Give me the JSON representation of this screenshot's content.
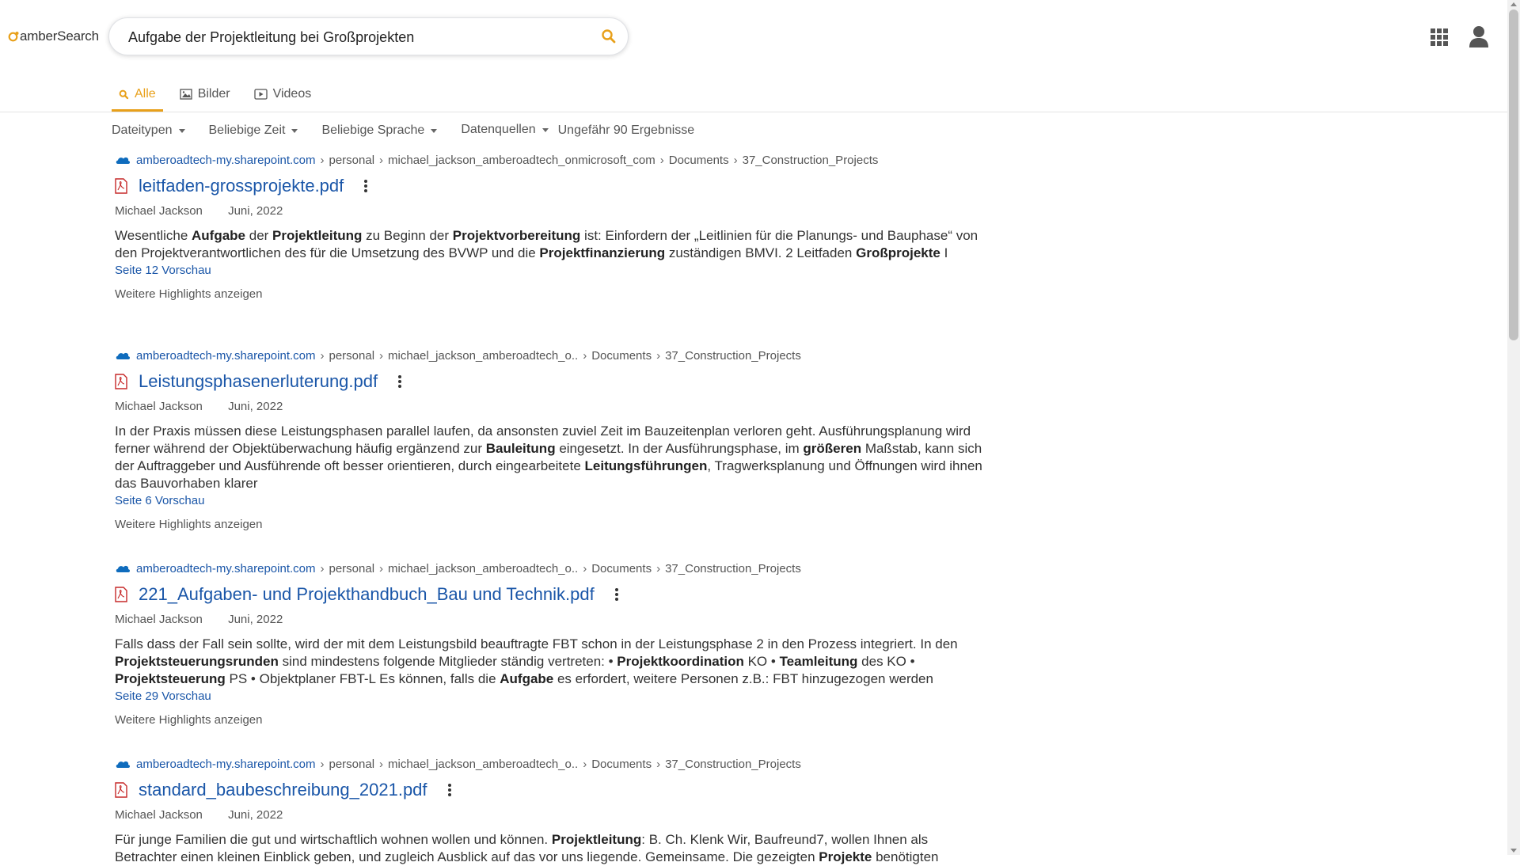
{
  "brand": {
    "name": "amberSearch",
    "accent_color": "#e8a01a",
    "link_color": "#1a56a8"
  },
  "search": {
    "query": "Aufgabe der Projektleitung bei Großprojekten"
  },
  "tabs": [
    {
      "label": "Alle",
      "icon": "search-icon",
      "active": true
    },
    {
      "label": "Bilder",
      "icon": "image-icon",
      "active": false
    },
    {
      "label": "Videos",
      "icon": "video-icon",
      "active": false
    }
  ],
  "filters": {
    "filetypes": "Dateitypen",
    "time": "Beliebige Zeit",
    "language": "Beliebige Sprache",
    "sources": "Datenquellen",
    "result_count": "Ungefähr 90 Ergebnisse"
  },
  "results": [
    {
      "host": "amberoadtech-my.sharepoint.com",
      "path": [
        "personal",
        "michael_jackson_amberoadtech_onmicrosoft_com",
        "Documents",
        "37_Construction_Projects"
      ],
      "title": "leitfaden-grossprojekte.pdf",
      "author": "Michael Jackson",
      "date": "Juni, 2022",
      "snippet": [
        {
          "t": "Wesentliche "
        },
        {
          "t": "Aufgabe",
          "b": true
        },
        {
          "t": " der "
        },
        {
          "t": "Projektleitung",
          "b": true
        },
        {
          "t": " zu Beginn der "
        },
        {
          "t": "Projektvorbereitung",
          "b": true
        },
        {
          "t": " ist: Einfordern der „Leitlinien für die Planungs- und Bauphase“ von den Projektverantwortlichen des für die Umsetzung des BVWP und die "
        },
        {
          "t": "Projektfinanzierung",
          "b": true
        },
        {
          "t": " zuständigen BMVI. 2 Leitfaden "
        },
        {
          "t": "Großprojekte",
          "b": true
        },
        {
          "t": " I"
        }
      ],
      "preview": "Seite 12 Vorschau",
      "highlights": "Weitere Highlights anzeigen"
    },
    {
      "host": "amberoadtech-my.sharepoint.com",
      "path": [
        "personal",
        "michael_jackson_amberoadtech_o..",
        "Documents",
        "37_Construction_Projects"
      ],
      "title": "Leistungsphasenerluterung.pdf",
      "author": "Michael Jackson",
      "date": "Juni, 2022",
      "snippet": [
        {
          "t": "In der Praxis müssen diese Leistungsphasen parallel laufen, da ansonsten zuviel Zeit im Bauzeitenplan verloren geht. Ausführungsplanung wird ferner während der Objektüberwachung häufig ergänzend zur "
        },
        {
          "t": "Bauleitung",
          "b": true
        },
        {
          "t": " eingesetzt. In der Ausführungsphase, im "
        },
        {
          "t": "größeren",
          "b": true
        },
        {
          "t": " Maßstab, kann sich der Auftraggeber und Ausführende oft besser orientieren, durch eingearbeitete "
        },
        {
          "t": "Leitungsführungen",
          "b": true
        },
        {
          "t": ", Tragwerksplanung und Öffnungen wird ihnen das Bauvorhaben klarer"
        }
      ],
      "preview": "Seite 6 Vorschau",
      "highlights": "Weitere Highlights anzeigen"
    },
    {
      "host": "amberoadtech-my.sharepoint.com",
      "path": [
        "personal",
        "michael_jackson_amberoadtech_o..",
        "Documents",
        "37_Construction_Projects"
      ],
      "title": "221_Aufgaben- und Projekthandbuch_Bau und Technik.pdf",
      "author": "Michael Jackson",
      "date": "Juni, 2022",
      "snippet": [
        {
          "t": "Falls dass der Fall sein sollte, wird der mit dem Leistungsbild beauftragte FBT schon in der Leistungsphase 2 in den Prozess integriert. In den "
        },
        {
          "t": "Projektsteuerungsrunden",
          "b": true
        },
        {
          "t": " sind mindestens folgende Mitglieder ständig vertreten: • "
        },
        {
          "t": "Projektkoordination",
          "b": true
        },
        {
          "t": " KO • "
        },
        {
          "t": "Teamleitung",
          "b": true
        },
        {
          "t": " des KO • "
        },
        {
          "t": "Projektsteuerung",
          "b": true
        },
        {
          "t": " PS • Objektplaner FBT-L Es können, falls die "
        },
        {
          "t": "Aufgabe",
          "b": true
        },
        {
          "t": " es erfordert, weitere Personen z.B.: FBT hinzugezogen werden"
        }
      ],
      "preview": "Seite 29 Vorschau",
      "highlights": "Weitere Highlights anzeigen"
    },
    {
      "host": "amberoadtech-my.sharepoint.com",
      "path": [
        "personal",
        "michael_jackson_amberoadtech_o..",
        "Documents",
        "37_Construction_Projects"
      ],
      "title": "standard_baubeschreibung_2021.pdf",
      "author": "Michael Jackson",
      "date": "Juni, 2022",
      "snippet": [
        {
          "t": "Für junge Familien die gut und wirtschaftlich wohnen wollen und können. "
        },
        {
          "t": "Projektleitung",
          "b": true
        },
        {
          "t": ": B. Ch. Klenk Wir, Baufreund7, wollen Ihnen als Betrachter einen kleinen Einblick geben, und zugleich Ausblick auf das vor uns liegende. Gemeinsame. Die gezeigten "
        },
        {
          "t": "Projekte",
          "b": true
        },
        {
          "t": " benötigten"
        }
      ],
      "preview": "",
      "highlights": ""
    }
  ]
}
